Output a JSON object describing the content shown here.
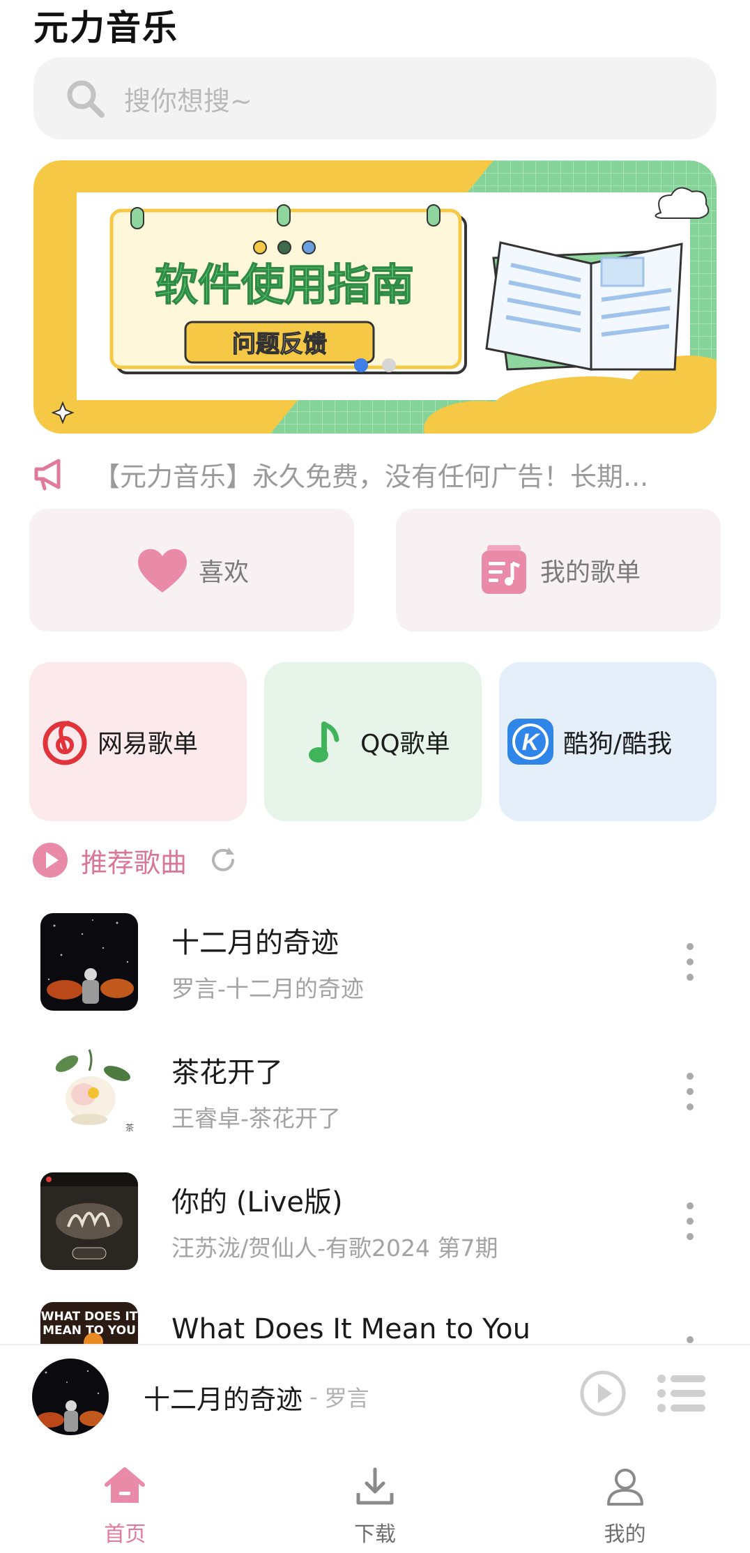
{
  "app": {
    "title": "元力音乐"
  },
  "search": {
    "placeholder": "搜你想搜~"
  },
  "banner": {
    "title": "软件使用指南",
    "button": "问题反馈"
  },
  "notice": {
    "text": "【元力音乐】永久免费，没有任何广告！长期..."
  },
  "quick": [
    {
      "label": "喜欢",
      "icon": "heart-icon"
    },
    {
      "label": "我的歌单",
      "icon": "playlist-icon"
    }
  ],
  "sources": [
    {
      "label": "网易歌单",
      "icon": "netease-icon"
    },
    {
      "label": "QQ歌单",
      "icon": "qq-music-icon"
    },
    {
      "label": "酷狗/酷我",
      "icon": "kugou-icon"
    }
  ],
  "recommend": {
    "label": "推荐歌曲"
  },
  "songs": [
    {
      "title": "十二月的奇迹",
      "subtitle": "罗言-十二月的奇迹"
    },
    {
      "title": "茶花开了",
      "subtitle": "王睿卓-茶花开了"
    },
    {
      "title": "你的 (Live版)",
      "subtitle": "汪苏泷/贺仙人-有歌2024 第7期"
    },
    {
      "title": "What Does It Mean to You",
      "subtitle": ""
    }
  ],
  "player": {
    "title": "十二月的奇迹",
    "separator": "-",
    "artist": "罗言"
  },
  "tabs": [
    {
      "label": "首页",
      "icon": "home-icon",
      "active": true
    },
    {
      "label": "下载",
      "icon": "download-icon",
      "active": false
    },
    {
      "label": "我的",
      "icon": "user-icon",
      "active": false
    }
  ],
  "colors": {
    "accent": "#e07a9c",
    "banner_yellow": "#f5c945",
    "banner_green": "#7fcf8e"
  }
}
